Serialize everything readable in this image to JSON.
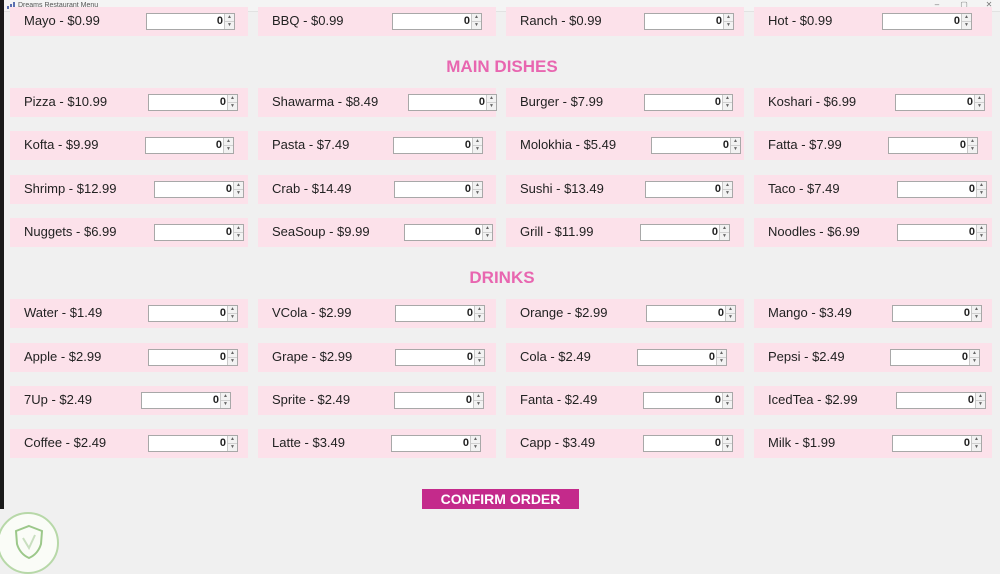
{
  "window": {
    "title": "Dreams Restaurant Menu"
  },
  "window_controls": {
    "minimize": "–",
    "maximize": "▢",
    "close": "✕"
  },
  "sections": [
    {
      "title": "",
      "items": [
        {
          "label": "Mayo - $0.99",
          "qty": "0"
        },
        {
          "label": "BBQ - $0.99",
          "qty": "0"
        },
        {
          "label": "Ranch - $0.99",
          "qty": "0"
        },
        {
          "label": "Hot - $0.99",
          "qty": "0"
        }
      ]
    },
    {
      "title": "MAIN DISHES",
      "items": [
        {
          "label": "Pizza - $10.99",
          "qty": "0"
        },
        {
          "label": "Shawarma - $8.49",
          "qty": "0"
        },
        {
          "label": "Burger - $7.99",
          "qty": "0"
        },
        {
          "label": "Koshari - $6.99",
          "qty": "0"
        },
        {
          "label": "Kofta - $9.99",
          "qty": "0"
        },
        {
          "label": "Pasta - $7.49",
          "qty": "0"
        },
        {
          "label": "Molokhia - $5.49",
          "qty": "0"
        },
        {
          "label": "Fatta - $7.99",
          "qty": "0"
        },
        {
          "label": "Shrimp - $12.99",
          "qty": "0"
        },
        {
          "label": "Crab - $14.49",
          "qty": "0"
        },
        {
          "label": "Sushi - $13.49",
          "qty": "0"
        },
        {
          "label": "Taco - $7.49",
          "qty": "0"
        },
        {
          "label": "Nuggets - $6.99",
          "qty": "0"
        },
        {
          "label": "SeaSoup - $9.99",
          "qty": "0"
        },
        {
          "label": "Grill - $11.99",
          "qty": "0"
        },
        {
          "label": "Noodles - $6.99",
          "qty": "0"
        }
      ]
    },
    {
      "title": "DRINKS",
      "items": [
        {
          "label": "Water - $1.49",
          "qty": "0"
        },
        {
          "label": "VCola - $2.99",
          "qty": "0"
        },
        {
          "label": "Orange - $2.99",
          "qty": "0"
        },
        {
          "label": "Mango - $3.49",
          "qty": "0"
        },
        {
          "label": "Apple - $2.99",
          "qty": "0"
        },
        {
          "label": "Grape - $2.99",
          "qty": "0"
        },
        {
          "label": "Cola - $2.49",
          "qty": "0"
        },
        {
          "label": "Pepsi - $2.49",
          "qty": "0"
        },
        {
          "label": "7Up - $2.49",
          "qty": "0"
        },
        {
          "label": "Sprite - $2.49",
          "qty": "0"
        },
        {
          "label": "Fanta - $2.49",
          "qty": "0"
        },
        {
          "label": "IcedTea - $2.99",
          "qty": "0"
        },
        {
          "label": "Coffee - $2.49",
          "qty": "0"
        },
        {
          "label": "Latte - $3.49",
          "qty": "0"
        },
        {
          "label": "Capp - $3.49",
          "qty": "0"
        },
        {
          "label": "Milk - $1.99",
          "qty": "0"
        }
      ]
    }
  ],
  "confirm_button": {
    "label": "CONFIRM ORDER"
  },
  "colors": {
    "section_title": "#e866b0",
    "item_background": "#fce1ea",
    "confirm_button": "#c42a8b",
    "window_background": "#f0f0f0"
  },
  "icons": [
    "app-icon",
    "spinner-up-icon",
    "spinner-down-icon",
    "watermark-logo"
  ]
}
